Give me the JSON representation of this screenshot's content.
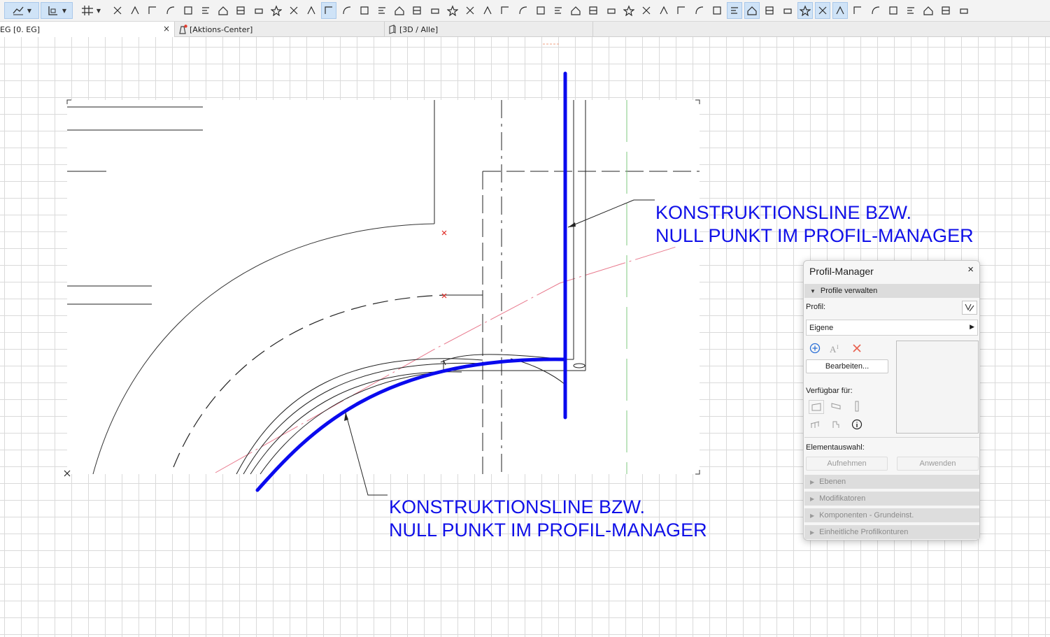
{
  "toolbar": {
    "icons": [
      "orientation-icon",
      "snap-icon",
      "grid-snap-icon",
      "trim-icon",
      "magic-wand-icon",
      "dimension-icon",
      "angle-icon",
      "rotate-icon",
      "offset-icon",
      "doc-icon",
      "edit-icon",
      "home-icon",
      "fill-icon",
      "layer-icon",
      "favorite-star-icon",
      "select-icon",
      "select-mode-icon",
      "image-icon",
      "roof-icon",
      "object-icon",
      "label-icon",
      "shape-icon",
      "circle-icon",
      "vertex-icon",
      "column-icon",
      "box-icon",
      "camera-icon",
      "group-icon",
      "stair-icon",
      "slab-icon",
      "mesh-icon",
      "morph-icon",
      "brush-icon",
      "table-icon",
      "layer-stack-icon",
      "section-icon",
      "beam-icon",
      "door-icon",
      "profile-icon",
      "hatch-icon",
      "fill-pattern-icon",
      "wall-icon",
      "zone-icon",
      "frame-icon",
      "trace-icon",
      "grid-icon",
      "dimension-auto-icon",
      "text-icon",
      "zoom-icon",
      "stair-roof-icon",
      "lift-icon",
      "plan-icon"
    ]
  },
  "tabs": [
    {
      "label": "EG [0. EG]",
      "close": "×"
    },
    {
      "label": "[Aktions-Center]"
    },
    {
      "label": "[3D / Alle]"
    }
  ],
  "annotations": {
    "top": {
      "line1": "KONSTRUKTIONSLINE BZW.",
      "line2": "NULL PUNKT IM PROFIL-MANAGER"
    },
    "bottom": {
      "line1": "KONSTRUKTIONSLINE BZW.",
      "line2": "NULL PUNKT IM PROFIL-MANAGER"
    }
  },
  "colors": {
    "annotation": "#1010e8",
    "highlight_line": "#0a0aee",
    "reference_line": "#e8788c",
    "guide_line": "#7fc97f",
    "marker": "#e0302a"
  },
  "panel": {
    "title": "Profil-Manager",
    "close": "×",
    "section_manage": "Profile verwalten",
    "profile_label": "Profil:",
    "profile_value": "Eigene",
    "edit_button": "Bearbeiten...",
    "available_label": "Verfügbar für:",
    "selection_label": "Elementauswahl:",
    "capture_button": "Aufnehmen",
    "apply_button": "Anwenden",
    "collapsed_sections": [
      "Ebenen",
      "Modifikatoren",
      "Komponenten - Grundeinst.",
      "Einheitliche Profilkonturen"
    ]
  }
}
